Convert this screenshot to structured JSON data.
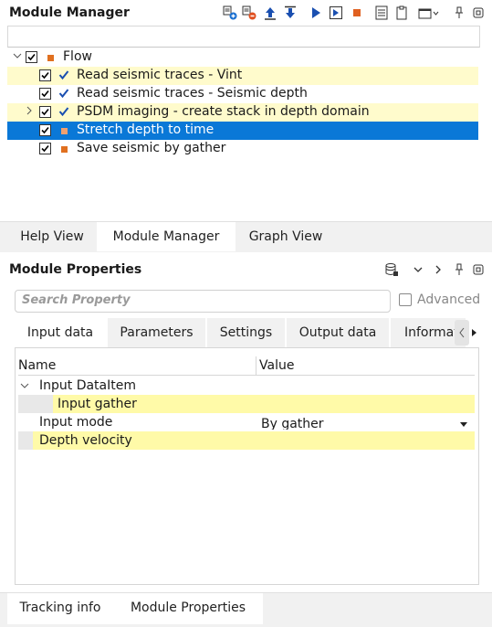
{
  "module_manager": {
    "title": "Module Manager",
    "toolbar_icons": [
      "add-module-icon",
      "remove-module-icon",
      "move-up-icon",
      "move-down-icon",
      "run-icon",
      "run-step-icon",
      "stop-icon",
      "list-icon",
      "clipboard-icon",
      "window-menu-icon",
      "pin-icon",
      "float-icon"
    ],
    "tree": {
      "root_label": "Flow",
      "items": [
        {
          "label": "Read seismic traces - Vint"
        },
        {
          "label": "Read seismic traces - Seismic depth"
        },
        {
          "label": "PSDM imaging - create stack in depth domain"
        },
        {
          "label": "Stretch depth to time"
        },
        {
          "label": "Save seismic by gather"
        }
      ]
    }
  },
  "bottom_tabs": [
    "Help View",
    "Module Manager",
    "Graph View"
  ],
  "module_properties": {
    "title": "Module Properties",
    "search_placeholder": "Search Property",
    "advanced_label": "Advanced",
    "tabs": [
      "Input data",
      "Parameters",
      "Settings",
      "Output data",
      "Informatio"
    ],
    "columns": [
      "Name",
      "Value"
    ],
    "group_label": "Input DataItem",
    "rows": [
      {
        "name": "Input gather",
        "value": ""
      },
      {
        "name": "Input mode",
        "value": "By gather"
      },
      {
        "name": "Depth velocity",
        "value": ""
      }
    ]
  },
  "footer_tabs": [
    "Tracking info",
    "Module Properties"
  ],
  "colors": {
    "selection": "#0a78d7",
    "highlight": "#fffbcc",
    "accent_square": "#e07020",
    "check_blue": "#1a4fb0"
  }
}
